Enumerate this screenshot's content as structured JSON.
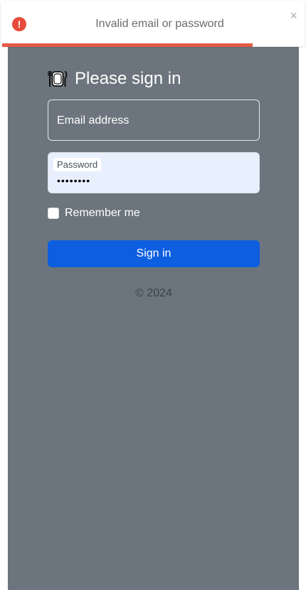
{
  "toast": {
    "icon": "exclamation-icon",
    "icon_glyph": "!",
    "message": "Invalid email or password",
    "close_glyph": "×",
    "color": "#e74c3c",
    "progress": 0.83
  },
  "form": {
    "heading_icon": "plate-cutlery-icon",
    "heading": "Please sign in",
    "email": {
      "placeholder": "Email address",
      "value": ""
    },
    "password": {
      "label": "Password",
      "value": "••••••••"
    },
    "remember_label": "Remember me",
    "remember_checked": false,
    "submit_label": "Sign in",
    "submit_color": "#0d5fe0"
  },
  "footer": {
    "copyright": "© 2024"
  },
  "colors": {
    "panel_background": "#6c757d"
  }
}
